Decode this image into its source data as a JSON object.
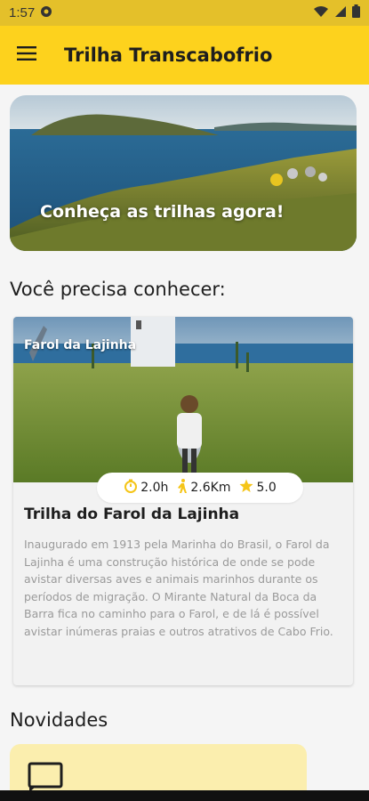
{
  "status_bar": {
    "time": "1:57",
    "icons": [
      "notification-icon",
      "wifi-icon",
      "signal-icon",
      "battery-icon"
    ]
  },
  "app_bar": {
    "title": "Trilha Transcabofrio",
    "menu_icon": "menu-icon",
    "color": "#fdd21d"
  },
  "hero": {
    "text": "Conheça as trilhas agora!"
  },
  "section_featured": {
    "title": "Você precisa conhecer:"
  },
  "trail_card": {
    "image_label": "Farol da Lajinha",
    "duration": "2.0h",
    "distance": "2.6Km",
    "rating": "5.0",
    "title": "Trilha do Farol da Lajinha",
    "description": "Inaugurado em 1913 pela Marinha do Brasil, o Farol da Lajinha é uma construção histórica de onde se pode avistar diversas aves e animais marinhos durante os períodos de migração. O Mirante Natural da Boca da Barra fica no caminho para o Farol, e de lá é possível avistar inúmeras praias e outros atrativos de Cabo Frio.",
    "accent": "#f5c518"
  },
  "section_news": {
    "title": "Novidades"
  },
  "news_card": {
    "icon": "message-icon",
    "color": "#fbeeae"
  }
}
